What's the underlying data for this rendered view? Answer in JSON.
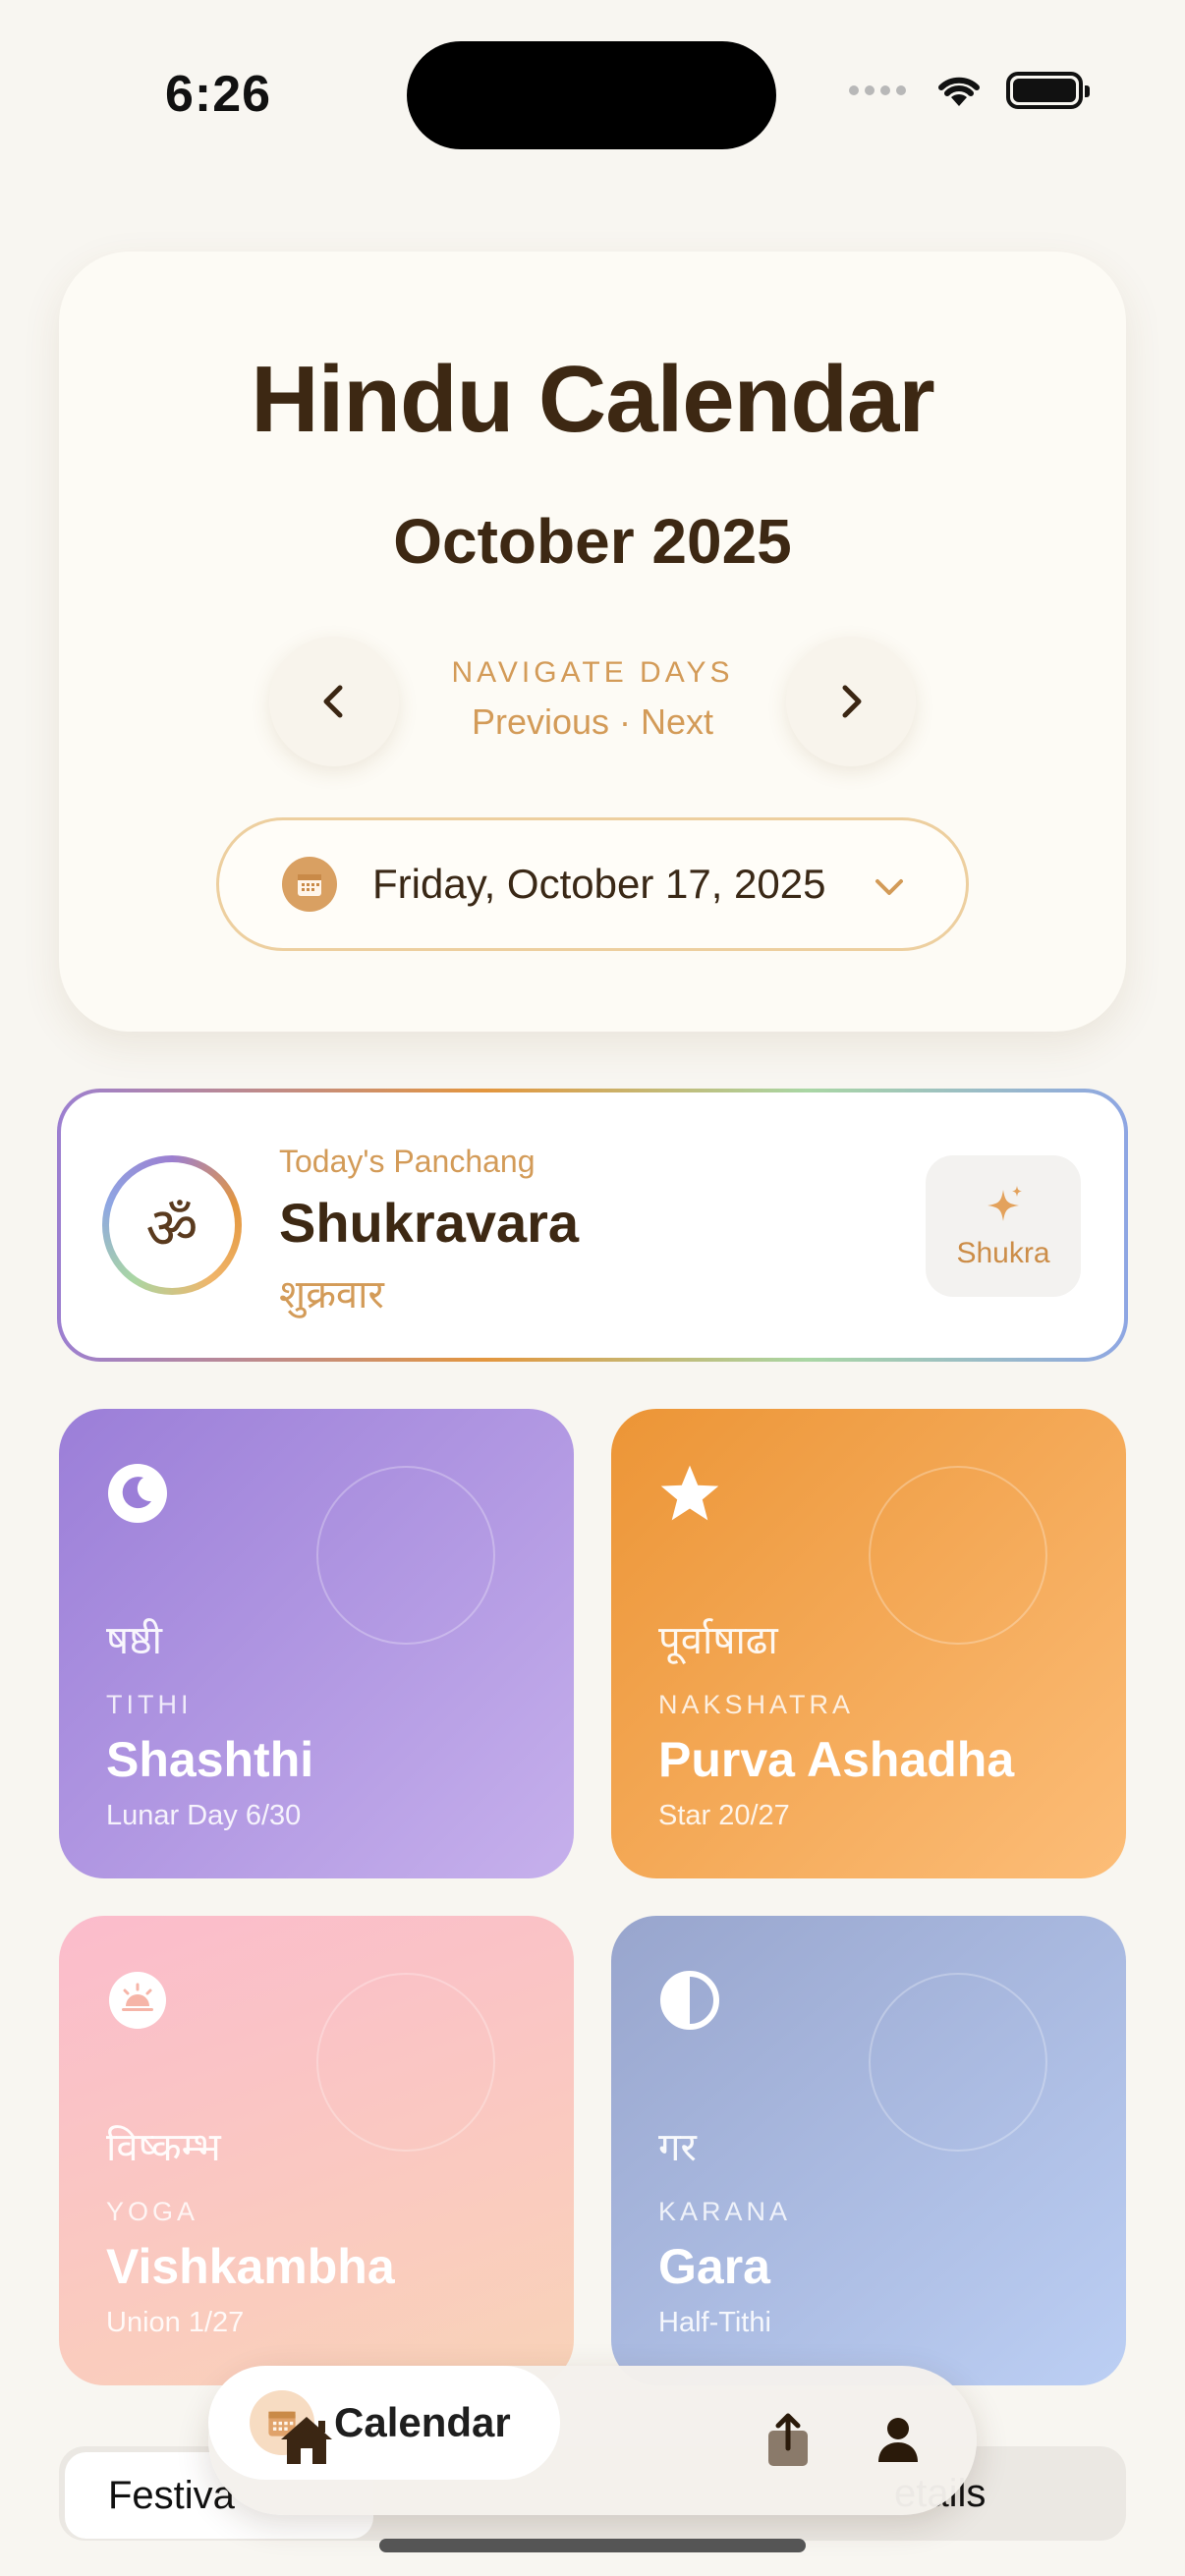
{
  "status_bar": {
    "time": "6:26"
  },
  "header": {
    "title": "Hindu Calendar",
    "month": "October 2025",
    "nav_caption": "NAVIGATE DAYS",
    "nav_sub": "Previous · Next",
    "selected_date": "Friday, October 17, 2025"
  },
  "panchang": {
    "label": "Today's Panchang",
    "day_name": "Shukravara",
    "day_deva": "शुक्रवार",
    "om_symbol": "ॐ",
    "planet_label": "Shukra"
  },
  "tiles": [
    {
      "deva": "षष्ठी",
      "category": "TITHI",
      "name": "Shashthi",
      "sub": "Lunar Day 6/30",
      "icon": "moon-icon"
    },
    {
      "deva": "पूर्वाषाढा",
      "category": "NAKSHATRA",
      "name": "Purva Ashadha",
      "sub": "Star 20/27",
      "icon": "star-icon"
    },
    {
      "deva": "विष्कम्भ",
      "category": "YOGA",
      "name": "Vishkambha",
      "sub": "Union 1/27",
      "icon": "sunrise-icon"
    },
    {
      "deva": "गर",
      "category": "KARANA",
      "name": "Gara",
      "sub": "Half-Tithi",
      "icon": "half-circle-icon"
    }
  ],
  "segmented": {
    "active": "Festiva",
    "right": "etails"
  },
  "tabbar": {
    "active_label": "Calendar"
  },
  "colors": {
    "accent": "#d39b58",
    "text_dark": "#3d2813",
    "tithi": "#9b7ed8",
    "nakshatra": "#ec9536",
    "yoga": "#fbbccc",
    "karana": "#98a5cd"
  }
}
